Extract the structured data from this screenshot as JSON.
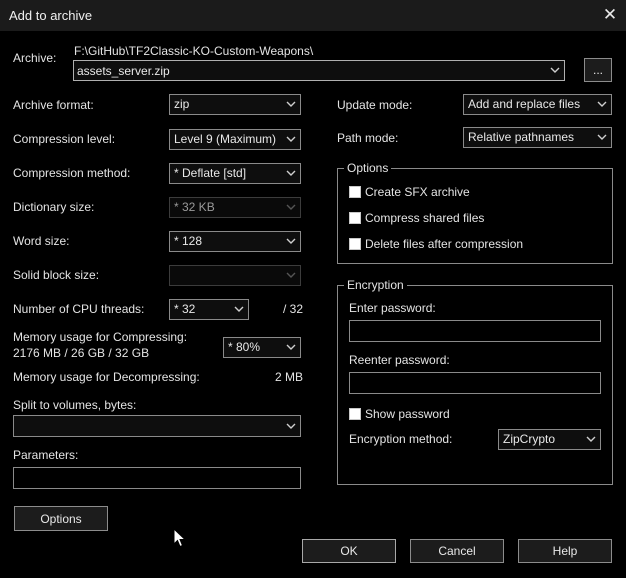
{
  "window": {
    "title": "Add to archive",
    "close_glyph": "✕"
  },
  "archive": {
    "label": "Archive:",
    "path": "F:\\GitHub\\TF2Classic-KO-Custom-Weapons\\",
    "filename": "assets_server.zip",
    "browse_label": "..."
  },
  "left": {
    "archive_format": {
      "label": "Archive format:",
      "value": "zip"
    },
    "compression_level": {
      "label": "Compression level:",
      "value": "Level 9 (Maximum)"
    },
    "compression_method": {
      "label": "Compression method:",
      "value": "*  Deflate [std]"
    },
    "dictionary_size": {
      "label": "Dictionary size:",
      "value": "*  32 KB"
    },
    "word_size": {
      "label": "Word size:",
      "value": "*  128"
    },
    "solid_block_size": {
      "label": "Solid block size:",
      "value": ""
    },
    "cpu_threads": {
      "label": "Number of CPU threads:",
      "value": "*  32",
      "max": "/ 32"
    },
    "memory_compress": {
      "label": "Memory usage for Compressing:",
      "detail": "2176 MB / 26 GB / 32 GB",
      "value": "* 80%"
    },
    "memory_decompress": {
      "label": "Memory usage for Decompressing:",
      "value": "2 MB"
    },
    "split_volumes": {
      "label": "Split to volumes, bytes:",
      "value": ""
    },
    "parameters": {
      "label": "Parameters:",
      "value": ""
    },
    "options_button": "Options"
  },
  "right": {
    "update_mode": {
      "label": "Update mode:",
      "value": "Add and replace files"
    },
    "path_mode": {
      "label": "Path mode:",
      "value": "Relative pathnames"
    },
    "options_group": {
      "legend": "Options",
      "create_sfx": "Create SFX archive",
      "compress_shared": "Compress shared files",
      "delete_after": "Delete files after compression"
    },
    "encryption": {
      "legend": "Encryption",
      "enter_password": "Enter password:",
      "reenter_password": "Reenter password:",
      "show_password": "Show password",
      "method_label": "Encryption method:",
      "method_value": "ZipCrypto"
    }
  },
  "buttons": {
    "ok": "OK",
    "cancel": "Cancel",
    "help": "Help"
  },
  "icons": {
    "dropdown_arrow": "chevron-down-icon",
    "close": "close-icon",
    "cursor": "mouse-pointer-icon"
  }
}
